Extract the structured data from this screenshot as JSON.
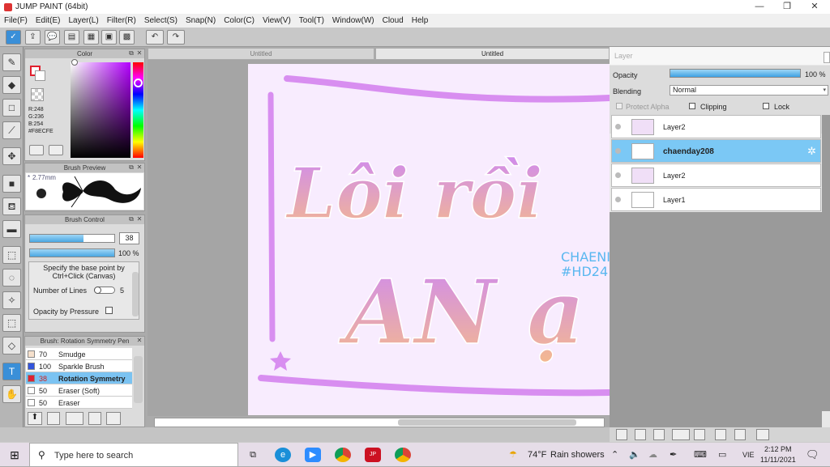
{
  "window": {
    "title": "JUMP PAINT (64bit)",
    "min": "—",
    "max": "❐",
    "close": "✕"
  },
  "menu": [
    "File(F)",
    "Edit(E)",
    "Layer(L)",
    "Filter(R)",
    "Select(S)",
    "Snap(N)",
    "Color(C)",
    "View(V)",
    "Tool(T)",
    "Window(W)",
    "Cloud",
    "Help"
  ],
  "tabs": {
    "left": "Untitled",
    "right": "Untitled"
  },
  "color": {
    "title": "Color",
    "r": "R:248",
    "g": "G:236",
    "b": "B:254",
    "hex": "#F8ECFE",
    "fg": "#e0202e"
  },
  "brush_preview": {
    "title": "Brush Preview",
    "size": "2.77mm"
  },
  "brush_control": {
    "title": "Brush Control",
    "size_value": "38",
    "opacity_value": "100 %",
    "hint": "Specify the base point by Ctrl+Click (Canvas)",
    "lines_label": "Number of Lines",
    "lines_value": "5",
    "pressure_label": "Opacity by Pressure"
  },
  "brush_list": {
    "title": "Brush: Rotation Symmetry Pen",
    "items": [
      {
        "size": "70",
        "name": "Smudge",
        "color": "#f5e0cc"
      },
      {
        "size": "100",
        "name": "Sparkle Brush",
        "color": "#3355dd"
      },
      {
        "size": "38",
        "name": "Rotation Symmetry",
        "color": "#dd2233"
      },
      {
        "size": "50",
        "name": "Eraser (Soft)",
        "color": "#ffffff"
      },
      {
        "size": "50",
        "name": "Eraser",
        "color": "#ffffff"
      }
    ]
  },
  "layer_panel": {
    "title": "Layer",
    "opacity_label": "Opacity",
    "opacity_value": "100 %",
    "blending_label": "Blending",
    "blending_value": "Normal",
    "protect_alpha": "Protect Alpha",
    "clipping": "Clipping",
    "lock": "Lock",
    "layers": [
      {
        "name": "Layer2"
      },
      {
        "name": "chaenday208"
      },
      {
        "name": "Layer2"
      },
      {
        "name": "Layer1"
      }
    ]
  },
  "canvas": {
    "line1": "Lôi rồi",
    "line2": "AN ạ",
    "side1": "CHAENI",
    "side2": "#HD24"
  },
  "taskbar": {
    "search_placeholder": "Type here to search",
    "weather_temp": "74°F",
    "weather_text": "Rain showers",
    "lang": "VIE",
    "time": "2:12 PM",
    "date": "11/11/2021"
  }
}
